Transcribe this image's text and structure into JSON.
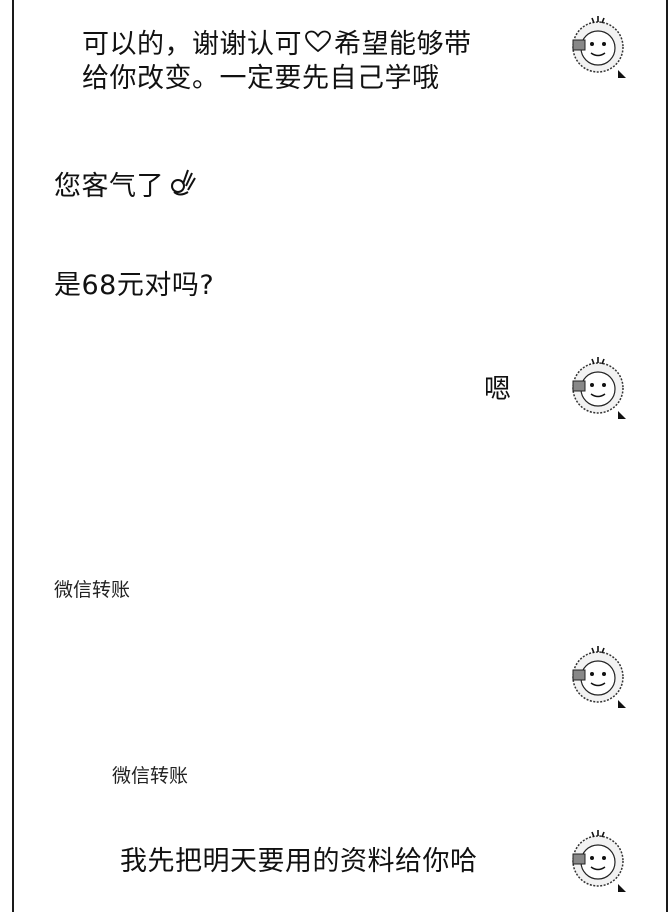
{
  "chat": {
    "messages": [
      {
        "id": "m1",
        "side": "right",
        "line1_before": "可以的，谢谢认可",
        "line1_emoji": "heart-icon",
        "line1_after": "希望能够带",
        "line2": "给你改变。一定要先自己学哦"
      },
      {
        "id": "m2",
        "side": "left",
        "text": "您客气了",
        "emoji": "ok-hand-icon"
      },
      {
        "id": "m3",
        "side": "left",
        "text": "是68元对吗?"
      },
      {
        "id": "m4",
        "side": "right",
        "text": "嗯"
      },
      {
        "id": "m5",
        "side": "left",
        "label": "微信转账"
      },
      {
        "id": "m6",
        "side": "right",
        "label": "微信转账"
      },
      {
        "id": "m7",
        "side": "right",
        "text": "我先把明天要用的资料给你哈"
      }
    ]
  }
}
